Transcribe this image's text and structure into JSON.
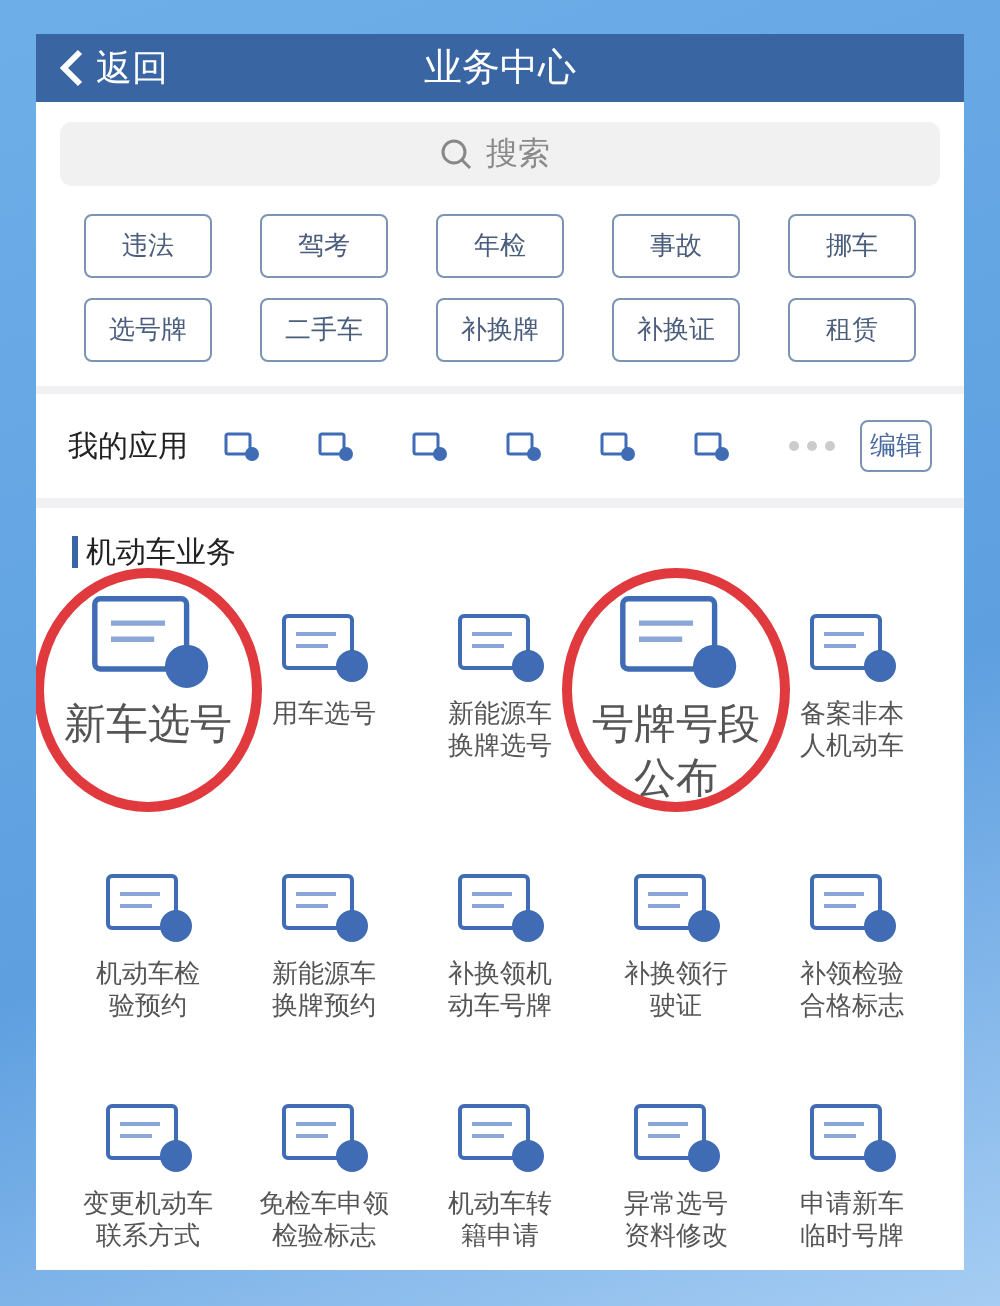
{
  "header": {
    "back_label": "返回",
    "title": "业务中心"
  },
  "search": {
    "placeholder": "搜索"
  },
  "quick_tags": [
    "违法",
    "驾考",
    "年检",
    "事故",
    "挪车",
    "选号牌",
    "二手车",
    "补换牌",
    "补换证",
    "租赁"
  ],
  "my_apps": {
    "title": "我的应用",
    "edit_label": "编辑"
  },
  "section": {
    "title": "机动车业务",
    "items": [
      {
        "label": "新车选号",
        "circled": true
      },
      {
        "label": "用车选号",
        "circled": false
      },
      {
        "label": "新能源车换牌选号",
        "circled": false
      },
      {
        "label": "号牌号段公布",
        "circled": true
      },
      {
        "label": "备案非本人机动车",
        "circled": false
      },
      {
        "label": "机动车检验预约",
        "circled": false
      },
      {
        "label": "新能源车换牌预约",
        "circled": false
      },
      {
        "label": "补换领机动车号牌",
        "circled": false
      },
      {
        "label": "补换领行驶证",
        "circled": false
      },
      {
        "label": "补领检验合格标志",
        "circled": false
      },
      {
        "label": "变更机动车联系方式",
        "circled": false
      },
      {
        "label": "免检车申领检验标志",
        "circled": false
      },
      {
        "label": "机动车转籍申请",
        "circled": false
      },
      {
        "label": "异常选号资料修改",
        "circled": false
      },
      {
        "label": "申请新车临时号牌",
        "circled": false
      }
    ]
  }
}
